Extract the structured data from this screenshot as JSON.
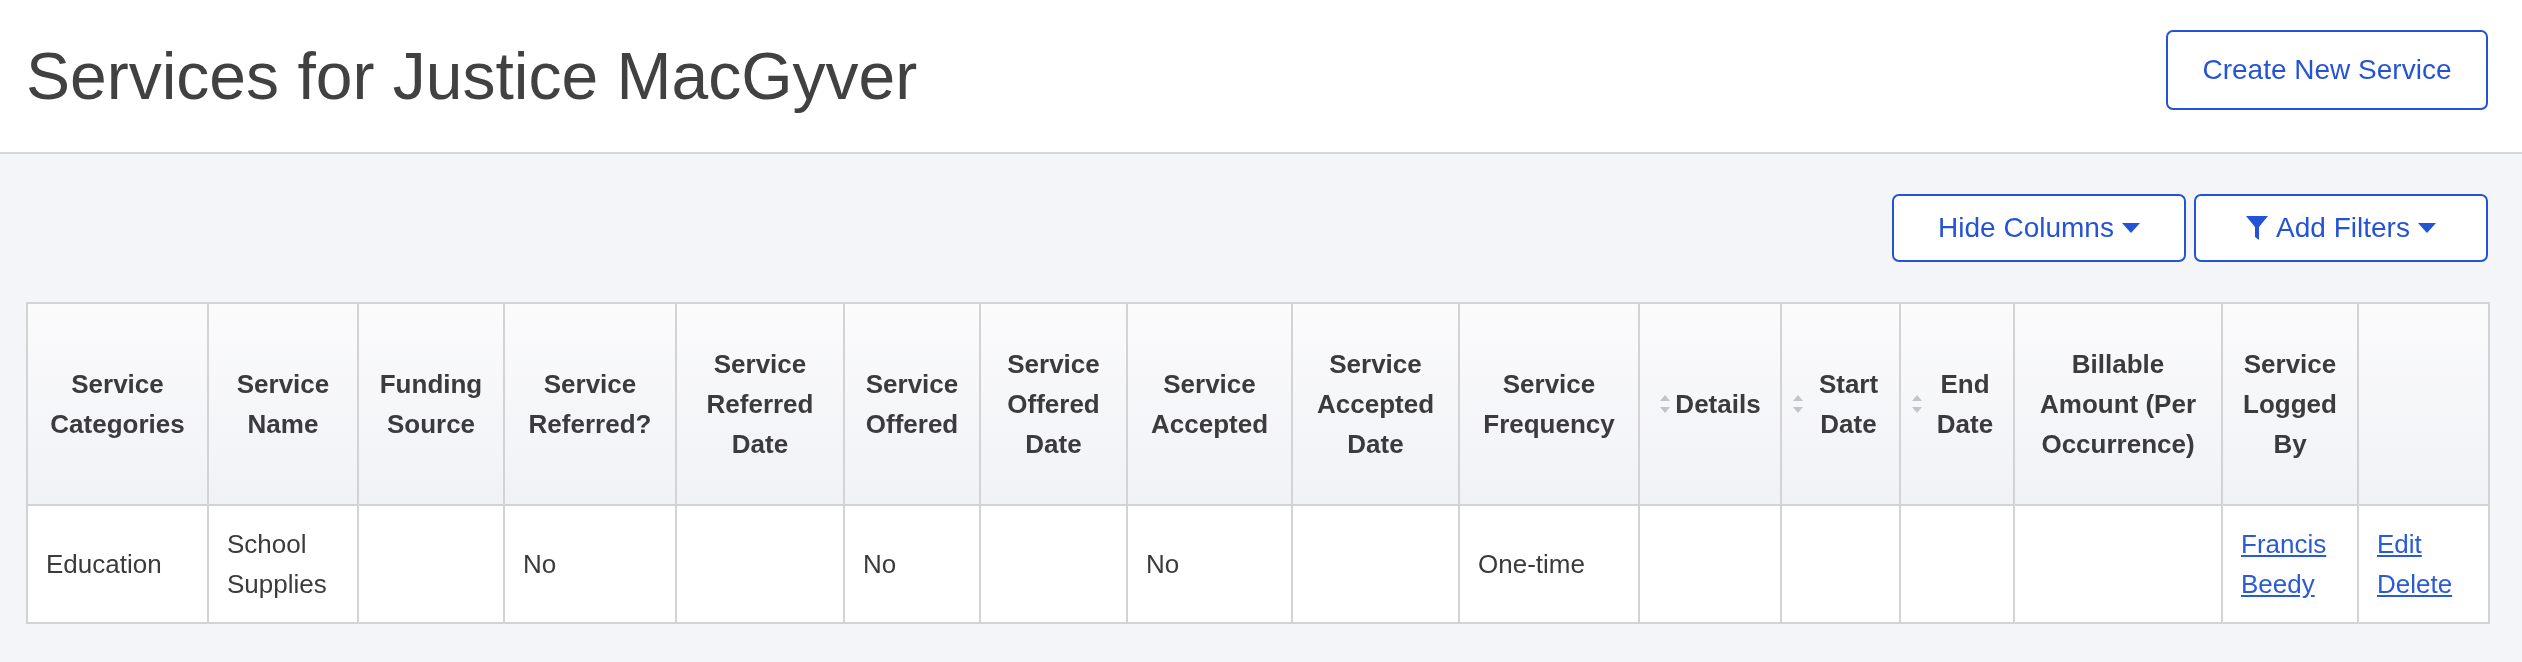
{
  "page": {
    "title": "Services for Justice MacGyver",
    "create_button": "Create New Service"
  },
  "toolbar": {
    "buttons": [
      {
        "label": "Hide Columns",
        "kind": "dropdown"
      },
      {
        "label": "Add Filters",
        "kind": "filter"
      }
    ]
  },
  "table": {
    "columns": [
      {
        "label": "Service Categories",
        "sortable": false
      },
      {
        "label": "Service Name",
        "sortable": false
      },
      {
        "label": "Funding Source",
        "sortable": false
      },
      {
        "label": "Service Referred?",
        "sortable": false
      },
      {
        "label": "Service Referred Date",
        "sortable": false
      },
      {
        "label": "Service Offered",
        "sortable": false
      },
      {
        "label": "Service Offered Date",
        "sortable": false
      },
      {
        "label": "Service Accepted",
        "sortable": false
      },
      {
        "label": "Service Accepted Date",
        "sortable": false
      },
      {
        "label": "Service Frequency",
        "sortable": false
      },
      {
        "label": "Details",
        "sortable": true
      },
      {
        "label": "Start Date",
        "sortable": true
      },
      {
        "label": "End Date",
        "sortable": true
      },
      {
        "label": "Billable Amount (Per Occurrence)",
        "sortable": false
      },
      {
        "label": "Service Logged By",
        "sortable": false
      }
    ],
    "rows": [
      {
        "cells": [
          {
            "kind": "text",
            "text": "Education"
          },
          {
            "kind": "text",
            "text": "School Supplies"
          },
          {
            "kind": "empty"
          },
          {
            "kind": "text",
            "text": "No"
          },
          {
            "kind": "empty"
          },
          {
            "kind": "text",
            "text": "No"
          },
          {
            "kind": "empty"
          },
          {
            "kind": "text",
            "text": "No"
          },
          {
            "kind": "empty"
          },
          {
            "kind": "text",
            "text": "One-time"
          },
          {
            "kind": "empty"
          },
          {
            "kind": "empty"
          },
          {
            "kind": "empty"
          },
          {
            "kind": "empty"
          },
          {
            "kind": "links",
            "links": [
              "Francis Beedy"
            ]
          },
          {
            "kind": "links",
            "links": [
              "Edit",
              "Delete"
            ]
          }
        ]
      }
    ]
  }
}
